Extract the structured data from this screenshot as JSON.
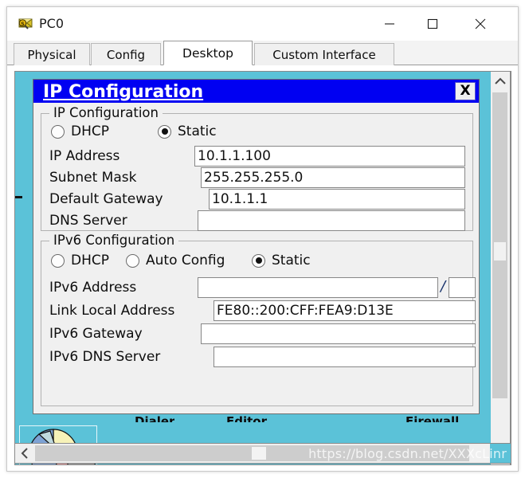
{
  "window": {
    "title": "PC0",
    "icon": "envelope-magnifier-icon",
    "controls": {
      "minimize_label": "—",
      "maximize_label": "□",
      "close_label": "×"
    }
  },
  "tabs": [
    {
      "label": "Physical",
      "active": false
    },
    {
      "label": "Config",
      "active": false
    },
    {
      "label": "Desktop",
      "active": true
    },
    {
      "label": "Custom Interface",
      "active": false
    }
  ],
  "dialog": {
    "title": "IP Configuration",
    "close_label": "X",
    "accent_color": "#0000f2",
    "desktop_background": "#5bc2d8"
  },
  "ipv4": {
    "group_title": "IP Configuration",
    "modes": [
      {
        "label": "DHCP",
        "selected": false
      },
      {
        "label": "Static",
        "selected": true
      }
    ],
    "fields": [
      {
        "label": "IP Address",
        "value": "10.1.1.100"
      },
      {
        "label": "Subnet Mask",
        "value": "255.255.255.0"
      },
      {
        "label": "Default Gateway",
        "value": "10.1.1.1"
      },
      {
        "label": "DNS Server",
        "value": ""
      }
    ]
  },
  "ipv6": {
    "group_title": "IPv6 Configuration",
    "modes": [
      {
        "label": "DHCP",
        "selected": false
      },
      {
        "label": "Auto Config",
        "selected": false
      },
      {
        "label": "Static",
        "selected": true
      }
    ],
    "fields": [
      {
        "label": "IPv6 Address",
        "value": ""
      },
      {
        "label": "Link Local Address",
        "value": "FE80::200:CFF:FEA9:D13E"
      },
      {
        "label": "IPv6 Gateway",
        "value": ""
      },
      {
        "label": "IPv6 DNS Server",
        "value": ""
      }
    ],
    "prefix_separator": "/",
    "prefix_value": ""
  },
  "desktop_icons": [
    {
      "label": "Dialer"
    },
    {
      "label": "Editor"
    },
    {
      "label": "Firewall"
    }
  ],
  "scrollbars": {
    "up_arrow": "∧",
    "down_arrow": "∨",
    "left_arrow": "‹",
    "right_arrow": "›"
  },
  "watermark": "https://blog.csdn.net/XXXcLinr"
}
